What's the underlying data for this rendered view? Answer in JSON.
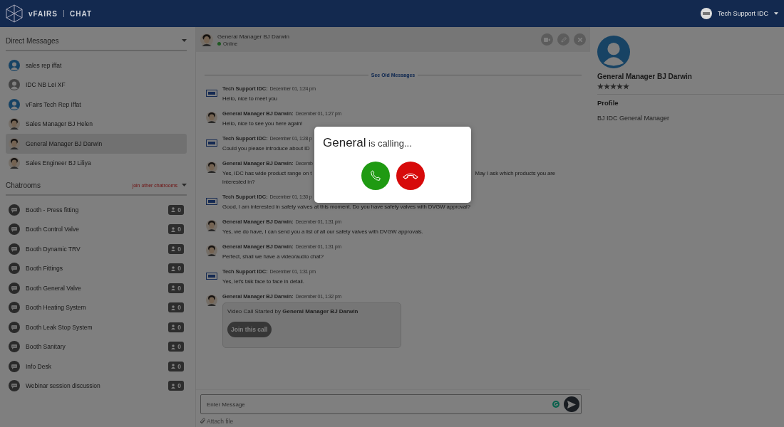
{
  "header": {
    "brand": "vFAIRS",
    "product": "CHAT",
    "user": "Tech Support IDC"
  },
  "direct_messages": {
    "title": "Direct Messages",
    "items": [
      {
        "name": "sales rep iffat",
        "kind": "blue",
        "selected": false
      },
      {
        "name": "IDC NB Lei XF",
        "kind": "grey",
        "selected": false
      },
      {
        "name": "vFairs Tech Rep Iffat",
        "kind": "blue",
        "selected": false
      },
      {
        "name": "Sales Manager BJ Helen",
        "kind": "person",
        "selected": false
      },
      {
        "name": "General Manager BJ Darwin",
        "kind": "person",
        "selected": true
      },
      {
        "name": "Sales Engineer BJ Liliya",
        "kind": "person",
        "selected": false
      }
    ]
  },
  "chatrooms": {
    "title": "Chatrooms",
    "link": "join other chatrooms",
    "items": [
      {
        "name": "Booth - Press fitting",
        "count": "0"
      },
      {
        "name": "Booth Control Valve",
        "count": "0"
      },
      {
        "name": "Booth Dynamic TRV",
        "count": "0"
      },
      {
        "name": "Booth Fittings",
        "count": "0"
      },
      {
        "name": "Booth General Valve",
        "count": "0"
      },
      {
        "name": "Booth Heating System",
        "count": "0"
      },
      {
        "name": "Booth Leak Stop System",
        "count": "0"
      },
      {
        "name": "Booth Sanitary",
        "count": "0"
      },
      {
        "name": "Info Desk",
        "count": "0"
      },
      {
        "name": "Webinar session discussion",
        "count": "0"
      }
    ]
  },
  "chat": {
    "contact": "General Manager BJ Darwin",
    "status": "Online",
    "see_old": "See Old Messages",
    "messages": [
      {
        "sender": "Tech Support IDC:",
        "kind": "logo",
        "time": "December 01, 1:24 pm",
        "lines": [
          [
            "Hello, nice to meet you"
          ]
        ]
      },
      {
        "sender": "General Manager BJ Darwin:",
        "kind": "person",
        "time": "December 01, 1:27 pm",
        "lines": [
          [
            "Hello, nice to see you here again!"
          ]
        ]
      },
      {
        "sender": "Tech Support IDC:",
        "kind": "logo",
        "time": "December 01, 1:28 p",
        "lines": [
          [
            "Could you please introduce about ID"
          ]
        ]
      },
      {
        "sender": "General Manager BJ Darwin:",
        "kind": "person",
        "time": "Decemb",
        "lines": [
          [
            "Yes, IDC has wide product range on t",
            "May I ask which products you are"
          ],
          [
            "interested in?"
          ]
        ]
      },
      {
        "sender": "Tech Support IDC:",
        "kind": "logo",
        "time": "December 01, 1:30 p",
        "lines": [
          [
            "Good, I am interested in safety valves at this moment. Do you have safety valves with DVGW approval?"
          ]
        ]
      },
      {
        "sender": "General Manager BJ Darwin:",
        "kind": "person",
        "time": "December 01, 1:31 pm",
        "lines": [
          [
            "Yes, we do have, I can send you a list of all our safety valves with DVGW approvals."
          ]
        ]
      },
      {
        "sender": "General Manager BJ Darwin:",
        "kind": "person",
        "time": "December 01, 1:31 pm",
        "lines": [
          [
            "Perfect, shall we have a video/audio chat?"
          ]
        ]
      },
      {
        "sender": "Tech Support IDC:",
        "kind": "logo",
        "time": "December 01, 1:31 pm",
        "lines": [
          [
            "Yes, let's talk face to face in detail."
          ]
        ]
      },
      {
        "sender": "General Manager BJ Darwin:",
        "kind": "person",
        "time": "December 01, 1:32 pm",
        "call_card": {
          "text": "Video Call Started by **General Manager BJ Darwin**",
          "button": "Join this call"
        }
      }
    ],
    "input": {
      "placeholder": "Enter Message"
    },
    "attach": "Attach file"
  },
  "profile": {
    "name": "General Manager BJ Darwin",
    "stars": 5,
    "section": "Profile",
    "text": "BJ IDC General Manager"
  },
  "call": {
    "text": "**General** is calling..."
  }
}
